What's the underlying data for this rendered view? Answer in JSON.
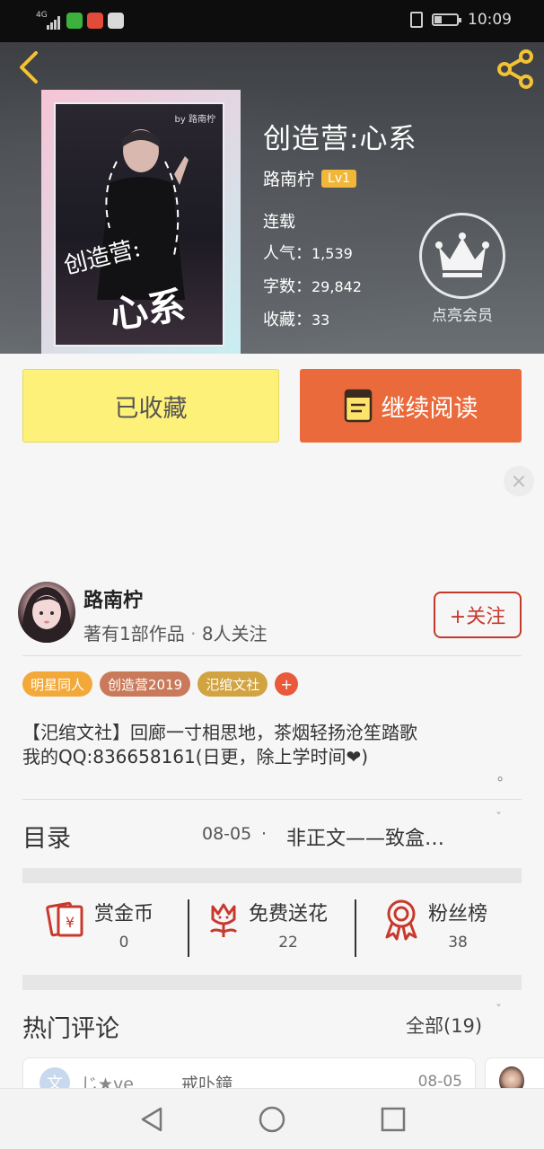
{
  "status_bar": {
    "network": "4G",
    "time": "10:09"
  },
  "header": {
    "book_title": "创造营:心系",
    "author": "路南柠",
    "level": "Lv1",
    "status": "连载",
    "popularity_label": "人气：",
    "popularity": "1,539",
    "words_label": "字数：",
    "words": "29,842",
    "favorites_label": "收藏：",
    "favorites": "33",
    "vip_label": "点亮会员",
    "cover": {
      "title_line1": "创造营:",
      "title_line2": "心系",
      "cover_author": "by 路南柠"
    }
  },
  "actions": {
    "collected_label": "已收藏",
    "read_label": "继续阅读"
  },
  "author_card": {
    "name": "路南柠",
    "works": "著有1部作品",
    "separator": "·",
    "followers": "8人关注",
    "follow_label": "+关注"
  },
  "tags": [
    {
      "label": "明星同人",
      "color": "#f3a93a"
    },
    {
      "label": "创造营2019",
      "color": "#c97a5a"
    },
    {
      "label": "汜绾文社",
      "color": "#d2a341"
    }
  ],
  "tag_add": "+",
  "description": {
    "line1": "【汜绾文社】回廊一寸相思地，茶烟轻扬沧笙踏歌",
    "line2": "我的QQ:836658161(日更，除上学时间❤)",
    "end": "。"
  },
  "toc": {
    "title": "目录",
    "date": "08-05",
    "dot": "·",
    "chapter": "非正文——致盒…"
  },
  "stats": [
    {
      "label": "赏金币",
      "value": "0",
      "icon": "red-envelope-icon"
    },
    {
      "label": "免费送花",
      "value": "22",
      "icon": "flower-icon"
    },
    {
      "label": "粉丝榜",
      "value": "38",
      "icon": "medal-icon"
    }
  ],
  "hot_comments": {
    "title": "热门评论",
    "all_label": "全部(19)",
    "first": {
      "avatar_letter": "文",
      "name": "じ★ve",
      "text": "戒卟鐘",
      "date": "08-05"
    }
  },
  "colors": {
    "accent_orange": "#ea6a3c",
    "collected_yellow": "#fef17a",
    "follow_red": "#c5392d",
    "level_gold": "#f0b73a"
  }
}
